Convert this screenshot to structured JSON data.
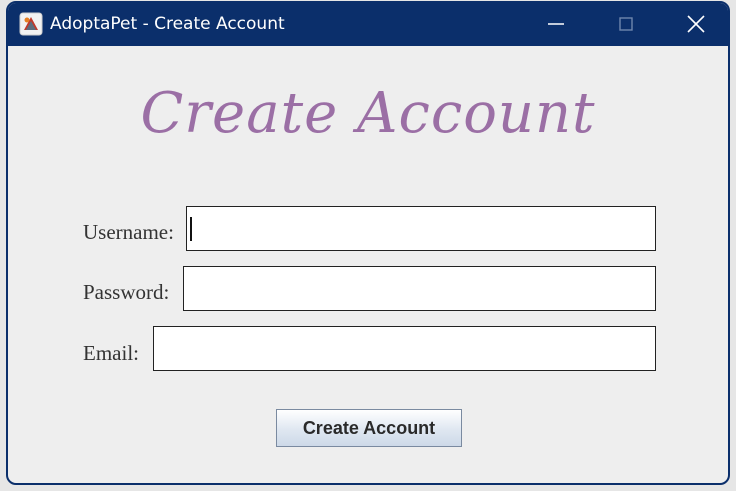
{
  "window": {
    "title": "AdoptaPet - Create Account",
    "app_icon": "java-app-icon",
    "controls": [
      "minimize-icon",
      "maximize-icon",
      "close-icon"
    ],
    "titlebar_color": "#0b2f6b"
  },
  "form": {
    "heading": "Create Account",
    "heading_color": "#9b6fa5",
    "fields": [
      {
        "label": "Username:",
        "value": "",
        "focused": true
      },
      {
        "label": "Password:",
        "value": ""
      },
      {
        "label": "Email:",
        "value": ""
      }
    ],
    "submit_label": "Create Account"
  }
}
